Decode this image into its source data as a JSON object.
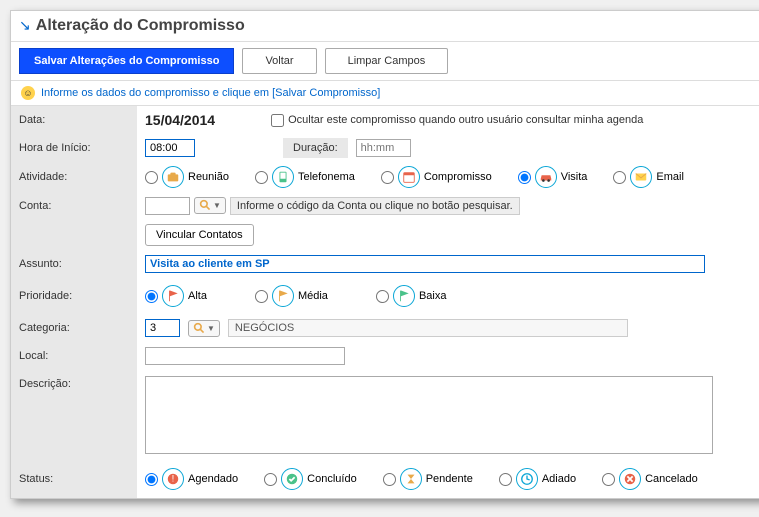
{
  "header": {
    "title": "Alteração do Compromisso"
  },
  "toolbar": {
    "save": "Salvar Alterações do Compromisso",
    "back": "Voltar",
    "clear": "Limpar Campos"
  },
  "info": "Informe os dados do compromisso e clique em [Salvar Compromisso]",
  "labels": {
    "data": "Data:",
    "hora": "Hora de Início:",
    "atividade": "Atividade:",
    "conta": "Conta:",
    "assunto": "Assunto:",
    "prioridade": "Prioridade:",
    "categoria": "Categoria:",
    "local": "Local:",
    "descricao": "Descrição:",
    "status": "Status:",
    "duracao": "Duração:"
  },
  "data_value": "15/04/2014",
  "hide_checkbox": "Ocultar este compromisso quando outro usuário consultar minha agenda",
  "hora_value": "08:00",
  "duracao_placeholder": "hh:mm",
  "atividades": {
    "reuniao": "Reunião",
    "telefonema": "Telefonema",
    "compromisso": "Compromisso",
    "visita": "Visita",
    "email": "Email"
  },
  "conta_hint": "Informe o código da Conta ou clique no botão pesquisar.",
  "vincular": "Vincular Contatos",
  "assunto_value": "Visita ao cliente em SP",
  "prioridades": {
    "alta": "Alta",
    "media": "Média",
    "baixa": "Baixa"
  },
  "categoria_value": "3",
  "categoria_name": "NEGÓCIOS",
  "status_opts": {
    "agendado": "Agendado",
    "concluido": "Concluído",
    "pendente": "Pendente",
    "adiado": "Adiado",
    "cancelado": "Cancelado"
  }
}
